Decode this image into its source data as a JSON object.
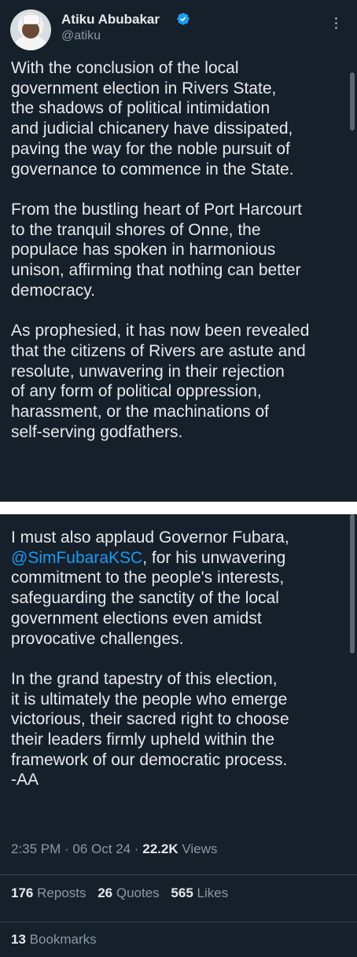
{
  "tweet": {
    "author_name": "Atiku Abubakar",
    "author_handle": "@atiku",
    "verified_badge_icon": "verified-badge-icon",
    "more_icon": "more-vertical-icon",
    "part1_text": "With the conclusion of the local\ngovernment election in Rivers State,\nthe shadows of political intimidation\nand judicial chicanery have dissipated,\npaving the way for the noble pursuit of\ngovernance to commence in the State.\n\nFrom the bustling heart of Port Harcourt\nto the tranquil shores of Onne, the\npopulace has spoken in harmonious\nunison, affirming that nothing can better\ndemocracy.\n\nAs prophesied, it has now been revealed\nthat the citizens of Rivers are astute and\nresolute, unwavering in their rejection\nof any form of political oppression,\nharassment, or the machinations of\nself-serving godfathers.",
    "part2_intro": "I must also applaud Governor Fubara,",
    "part2_mention": "@SimFubaraKSC",
    "part2_text": ", for his unwavering\ncommitment to the people's interests,\nsafeguarding the sanctity of the local\ngovernment elections even amidst\nprovocative challenges.\n\nIn the grand tapestry of this election,\nit is ultimately the people who emerge\nvictorious, their sacred right to choose\ntheir leaders firmly upheld within the\nframework of our democratic process.\n-AA",
    "timestamp": "2:35 PM · 06 Oct 24 · ",
    "views_count": "22.2K",
    "views_label": " Views",
    "reposts_count": "176",
    "reposts_label": " Reposts",
    "quotes_count": "26",
    "quotes_label": " Quotes",
    "likes_count": "565",
    "likes_label": " Likes",
    "bookmarks_count": "13",
    "bookmarks_label": " Bookmarks"
  },
  "colors": {
    "background": "#15202b",
    "text_primary": "#e7e9ea",
    "text_secondary": "#8b98a5",
    "link": "#1d9bf0",
    "divider": "#38444d",
    "verified": "#1d9bf0"
  }
}
